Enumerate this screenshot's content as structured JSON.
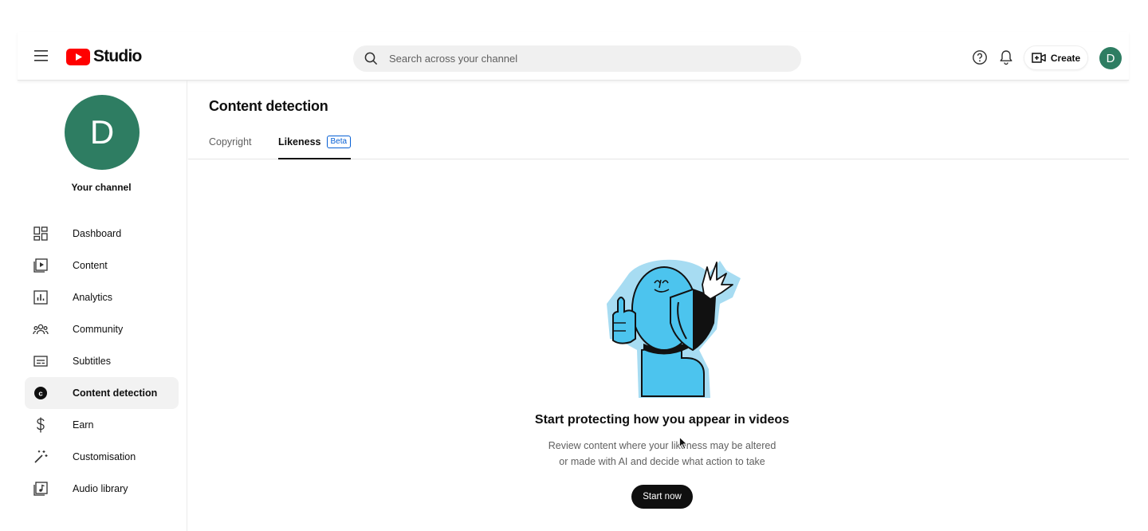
{
  "app": {
    "logo_text": "Studio",
    "brand_color": "#ff0000"
  },
  "header": {
    "search_placeholder": "Search across your channel",
    "create_label": "Create",
    "avatar_initial": "D",
    "avatar_color": "#2e7d62"
  },
  "sidebar": {
    "channel_initial": "D",
    "channel_label": "Your channel",
    "items": [
      {
        "label": "Dashboard",
        "icon": "dashboard-icon"
      },
      {
        "label": "Content",
        "icon": "content-icon"
      },
      {
        "label": "Analytics",
        "icon": "analytics-icon"
      },
      {
        "label": "Community",
        "icon": "community-icon"
      },
      {
        "label": "Subtitles",
        "icon": "subtitles-icon"
      },
      {
        "label": "Content detection",
        "icon": "content-detection-icon",
        "active": true
      },
      {
        "label": "Earn",
        "icon": "dollar-icon"
      },
      {
        "label": "Customisation",
        "icon": "magic-wand-icon"
      },
      {
        "label": "Audio library",
        "icon": "audio-library-icon"
      }
    ]
  },
  "main": {
    "title": "Content detection",
    "tabs": [
      {
        "label": "Copyright",
        "active": false
      },
      {
        "label": "Likeness",
        "active": true,
        "badge": "Beta"
      }
    ],
    "empty_state": {
      "title": "Start protecting how you appear in videos",
      "desc_line1": "Review content where your likeness may be altered",
      "desc_line2": "or made with AI and decide what action to take",
      "button": "Start now"
    }
  }
}
